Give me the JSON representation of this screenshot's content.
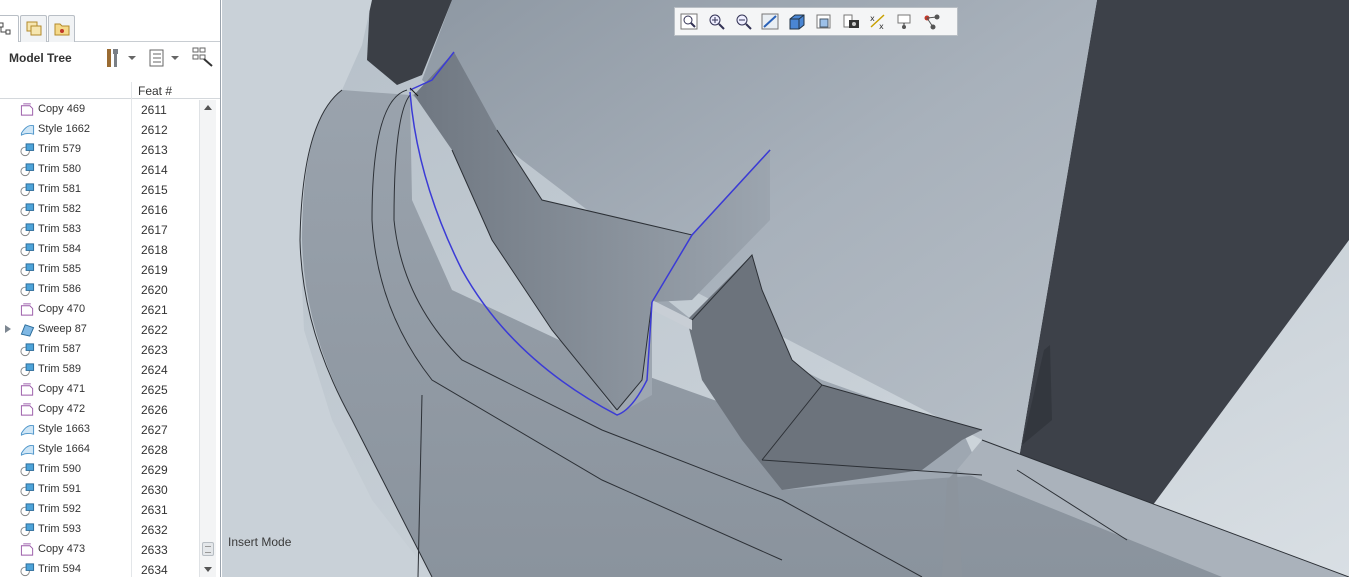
{
  "model_tree": {
    "title": "Model Tree",
    "column_feat": "Feat #",
    "tabs": [
      "model-tree-icon",
      "layers-icon",
      "favorites-icon"
    ],
    "rows": [
      {
        "name": "Copy 469",
        "feat": "2611",
        "icon": "copy-icon"
      },
      {
        "name": "Style 1662",
        "feat": "2612",
        "icon": "style-icon"
      },
      {
        "name": "Trim 579",
        "feat": "2613",
        "icon": "trim-icon"
      },
      {
        "name": "Trim 580",
        "feat": "2614",
        "icon": "trim-icon"
      },
      {
        "name": "Trim 581",
        "feat": "2615",
        "icon": "trim-icon"
      },
      {
        "name": "Trim 582",
        "feat": "2616",
        "icon": "trim-icon"
      },
      {
        "name": "Trim 583",
        "feat": "2617",
        "icon": "trim-icon"
      },
      {
        "name": "Trim 584",
        "feat": "2618",
        "icon": "trim-icon"
      },
      {
        "name": "Trim 585",
        "feat": "2619",
        "icon": "trim-icon"
      },
      {
        "name": "Trim 586",
        "feat": "2620",
        "icon": "trim-icon"
      },
      {
        "name": "Copy 470",
        "feat": "2621",
        "icon": "copy-icon"
      },
      {
        "name": "Sweep 87",
        "feat": "2622",
        "icon": "sweep-icon",
        "expandable": true
      },
      {
        "name": "Trim 587",
        "feat": "2623",
        "icon": "trim-icon"
      },
      {
        "name": "Trim 589",
        "feat": "2624",
        "icon": "trim-icon"
      },
      {
        "name": "Copy 471",
        "feat": "2625",
        "icon": "copy-icon"
      },
      {
        "name": "Copy 472",
        "feat": "2626",
        "icon": "copy-icon"
      },
      {
        "name": "Style 1663",
        "feat": "2627",
        "icon": "style-icon"
      },
      {
        "name": "Style 1664",
        "feat": "2628",
        "icon": "style-icon"
      },
      {
        "name": "Trim 590",
        "feat": "2629",
        "icon": "trim-icon"
      },
      {
        "name": "Trim 591",
        "feat": "2630",
        "icon": "trim-icon"
      },
      {
        "name": "Trim 592",
        "feat": "2631",
        "icon": "trim-icon"
      },
      {
        "name": "Trim 593",
        "feat": "2632",
        "icon": "trim-icon"
      },
      {
        "name": "Copy 473",
        "feat": "2633",
        "icon": "copy-icon"
      },
      {
        "name": "Trim 594",
        "feat": "2634",
        "icon": "trim-icon"
      }
    ]
  },
  "view_toolbar": {
    "buttons": [
      "zoom-fit-icon",
      "zoom-in-icon",
      "zoom-out-icon",
      "repaint-icon",
      "display-style-icon",
      "saved-views-icon",
      "snapshot-icon",
      "datum-display-icon",
      "spin-center-icon",
      "annotation-icon"
    ]
  },
  "status": "Insert Mode",
  "colors": {
    "accent_selection": "#3b3bd6",
    "surface_light": "#a9b2bc",
    "surface_dark": "#3c4048",
    "background": "#c2cbd3"
  }
}
